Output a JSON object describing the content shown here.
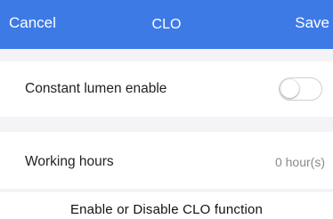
{
  "colors": {
    "header_background": "#3d7ae6",
    "header_text": "#ffffff",
    "section_gap": "#f4f4f6",
    "secondary_text": "#8a8a8a",
    "toggle_border": "#cfcfcf"
  },
  "header": {
    "cancel_label": "Cancel",
    "title": "CLO",
    "save_label": "Save"
  },
  "settings": {
    "constant_lumen": {
      "label": "Constant lumen enable",
      "enabled": false
    },
    "working_hours": {
      "label": "Working hours",
      "value": "0 hour(s)"
    }
  },
  "caption": "Enable or Disable CLO function"
}
